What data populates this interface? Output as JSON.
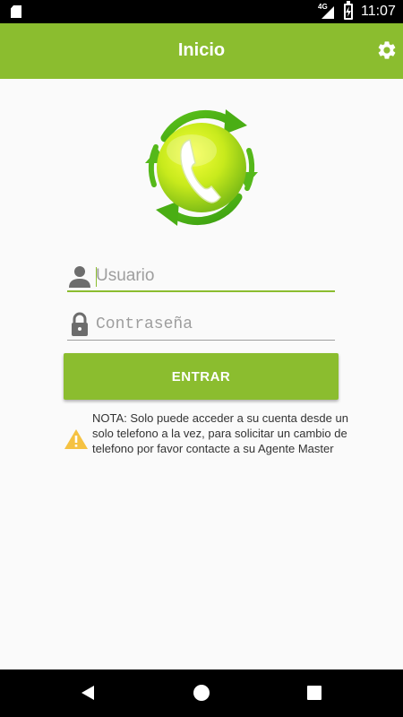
{
  "status_bar": {
    "time": "11:07",
    "network": "4G",
    "icons": [
      "sd-card-icon",
      "signal-icon",
      "battery-charging-icon"
    ]
  },
  "app_bar": {
    "title": "Inicio",
    "settings_icon": "gear-icon"
  },
  "logo": {
    "icon": "phone-refresh-logo",
    "colors": {
      "primary": "#8bbd2f",
      "highlight": "#d9f31a"
    }
  },
  "login_form": {
    "username": {
      "placeholder": "Usuario",
      "value": "",
      "icon": "user-icon"
    },
    "password": {
      "placeholder": "Contraseña",
      "value": "",
      "icon": "lock-icon"
    },
    "submit_label": "ENTRAR"
  },
  "note": {
    "icon": "warning-icon",
    "text": "NOTA: Solo puede acceder a su cuenta desde un solo telefono a la vez, para solicitar un cambio de telefono por favor contacte a su Agente Master"
  },
  "nav_bar": {
    "icons": [
      "back-icon",
      "home-icon",
      "recents-icon"
    ]
  },
  "theme": {
    "accent": "#8bbd2f",
    "warning": "#f5c242"
  }
}
